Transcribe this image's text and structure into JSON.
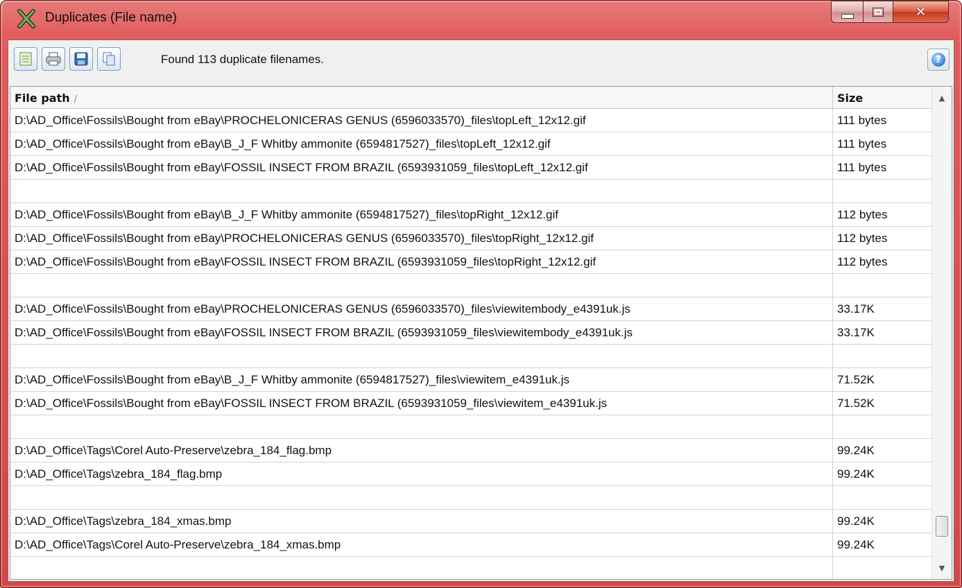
{
  "window": {
    "title": "Duplicates (File name)",
    "icon": "app-x-icon",
    "controls": {
      "minimize": "minimize-icon",
      "maximize": "maximize-icon",
      "close": "✕"
    }
  },
  "toolbar": {
    "buttons": [
      {
        "name": "report",
        "icon": "report-icon"
      },
      {
        "name": "print",
        "icon": "printer-icon"
      },
      {
        "name": "save",
        "icon": "floppy-disk-icon"
      },
      {
        "name": "copy",
        "icon": "copy-icon"
      }
    ],
    "status": "Found 113 duplicate filenames.",
    "help_glyph": "?"
  },
  "table": {
    "columns": {
      "path": "File path",
      "size": "Size"
    },
    "sort_glyph": "/",
    "rows": [
      {
        "path": "D:\\AD_Office\\Fossils\\Bought from eBay\\PROCHELONICERAS GENUS (6596033570)_files\\topLeft_12x12.gif",
        "size": "111 bytes"
      },
      {
        "path": "D:\\AD_Office\\Fossils\\Bought from eBay\\B_J_F Whitby ammonite (6594817527)_files\\topLeft_12x12.gif",
        "size": "111 bytes"
      },
      {
        "path": "D:\\AD_Office\\Fossils\\Bought from eBay\\FOSSIL INSECT FROM BRAZIL (6593931059_files\\topLeft_12x12.gif",
        "size": "111 bytes"
      },
      {
        "path": "",
        "size": ""
      },
      {
        "path": "D:\\AD_Office\\Fossils\\Bought from eBay\\B_J_F Whitby ammonite (6594817527)_files\\topRight_12x12.gif",
        "size": "112 bytes"
      },
      {
        "path": "D:\\AD_Office\\Fossils\\Bought from eBay\\PROCHELONICERAS GENUS (6596033570)_files\\topRight_12x12.gif",
        "size": "112 bytes"
      },
      {
        "path": "D:\\AD_Office\\Fossils\\Bought from eBay\\FOSSIL INSECT FROM BRAZIL (6593931059_files\\topRight_12x12.gif",
        "size": "112 bytes"
      },
      {
        "path": "",
        "size": ""
      },
      {
        "path": "D:\\AD_Office\\Fossils\\Bought from eBay\\PROCHELONICERAS GENUS (6596033570)_files\\viewitembody_e4391uk.js",
        "size": "33.17K"
      },
      {
        "path": "D:\\AD_Office\\Fossils\\Bought from eBay\\FOSSIL INSECT FROM BRAZIL (6593931059_files\\viewitembody_e4391uk.js",
        "size": "33.17K"
      },
      {
        "path": "",
        "size": ""
      },
      {
        "path": "D:\\AD_Office\\Fossils\\Bought from eBay\\B_J_F Whitby ammonite (6594817527)_files\\viewitem_e4391uk.js",
        "size": "71.52K"
      },
      {
        "path": "D:\\AD_Office\\Fossils\\Bought from eBay\\FOSSIL INSECT FROM BRAZIL (6593931059_files\\viewitem_e4391uk.js",
        "size": "71.52K"
      },
      {
        "path": "",
        "size": ""
      },
      {
        "path": "D:\\AD_Office\\Tags\\Corel Auto-Preserve\\zebra_184_flag.bmp",
        "size": "99.24K"
      },
      {
        "path": "D:\\AD_Office\\Tags\\zebra_184_flag.bmp",
        "size": "99.24K"
      },
      {
        "path": "",
        "size": ""
      },
      {
        "path": "D:\\AD_Office\\Tags\\zebra_184_xmas.bmp",
        "size": "99.24K"
      },
      {
        "path": "D:\\AD_Office\\Tags\\Corel Auto-Preserve\\zebra_184_xmas.bmp",
        "size": "99.24K"
      },
      {
        "path": "",
        "size": ""
      }
    ]
  },
  "scrollbar": {
    "position": 0.95,
    "up": "▲",
    "down": "▼"
  }
}
